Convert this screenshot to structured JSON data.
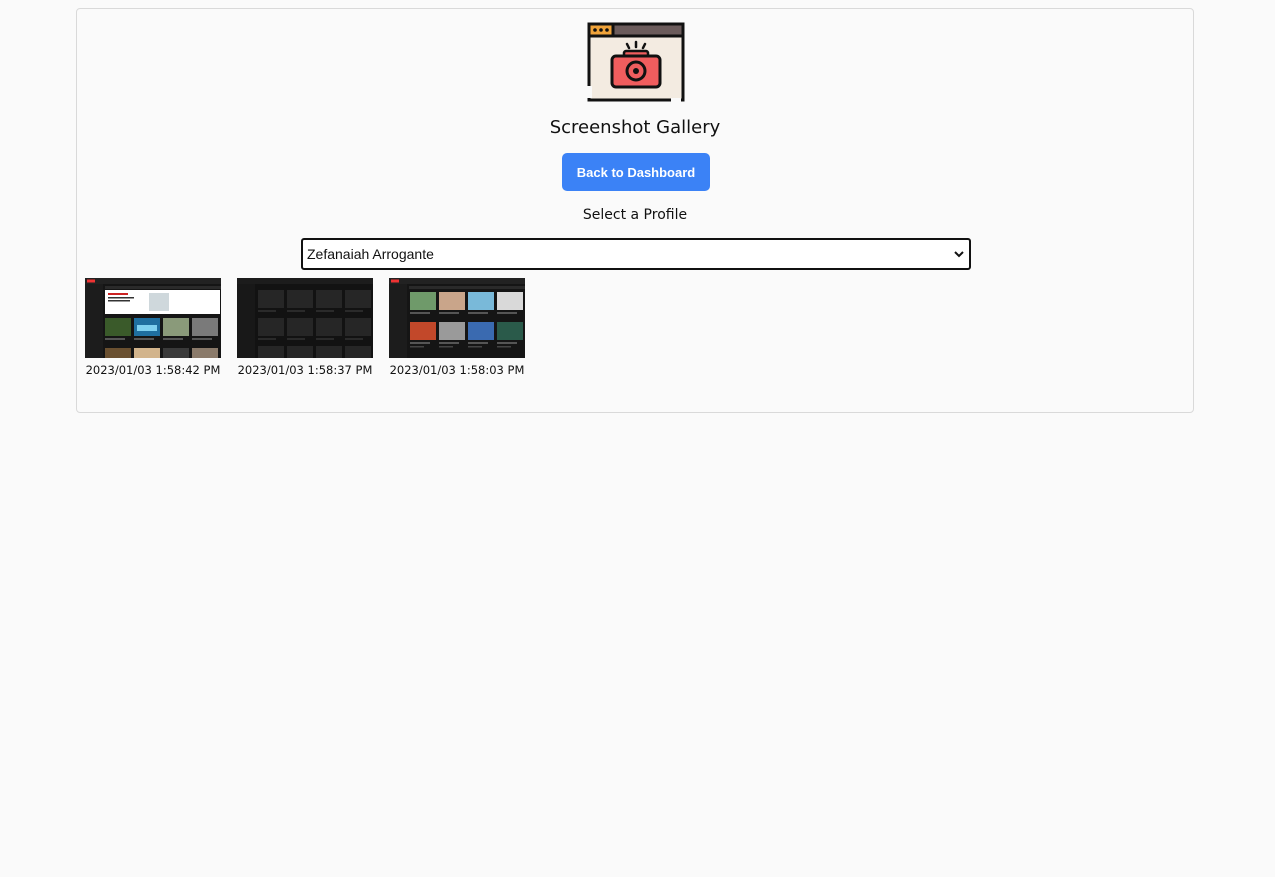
{
  "header": {
    "logo_icon": "camera-browser-icon",
    "title": "Screenshot Gallery"
  },
  "actions": {
    "back_label": "Back to Dashboard"
  },
  "profile": {
    "label": "Select a Profile",
    "selected": "Zefanaiah Arrogante",
    "options": [
      "Zefanaiah Arrogante"
    ]
  },
  "gallery": {
    "items": [
      {
        "timestamp": "2023/01/03 1:58:42 PM",
        "preview": "video-site-home-with-banner"
      },
      {
        "timestamp": "2023/01/03 1:58:37 PM",
        "preview": "video-site-loading-grid"
      },
      {
        "timestamp": "2023/01/03 1:58:03 PM",
        "preview": "video-site-home-grid"
      }
    ]
  },
  "colors": {
    "page_bg": "#fafafa",
    "accent": "#3b82f6",
    "camera_red": "#f05d5e",
    "logo_bg": "#f3ebe1"
  }
}
